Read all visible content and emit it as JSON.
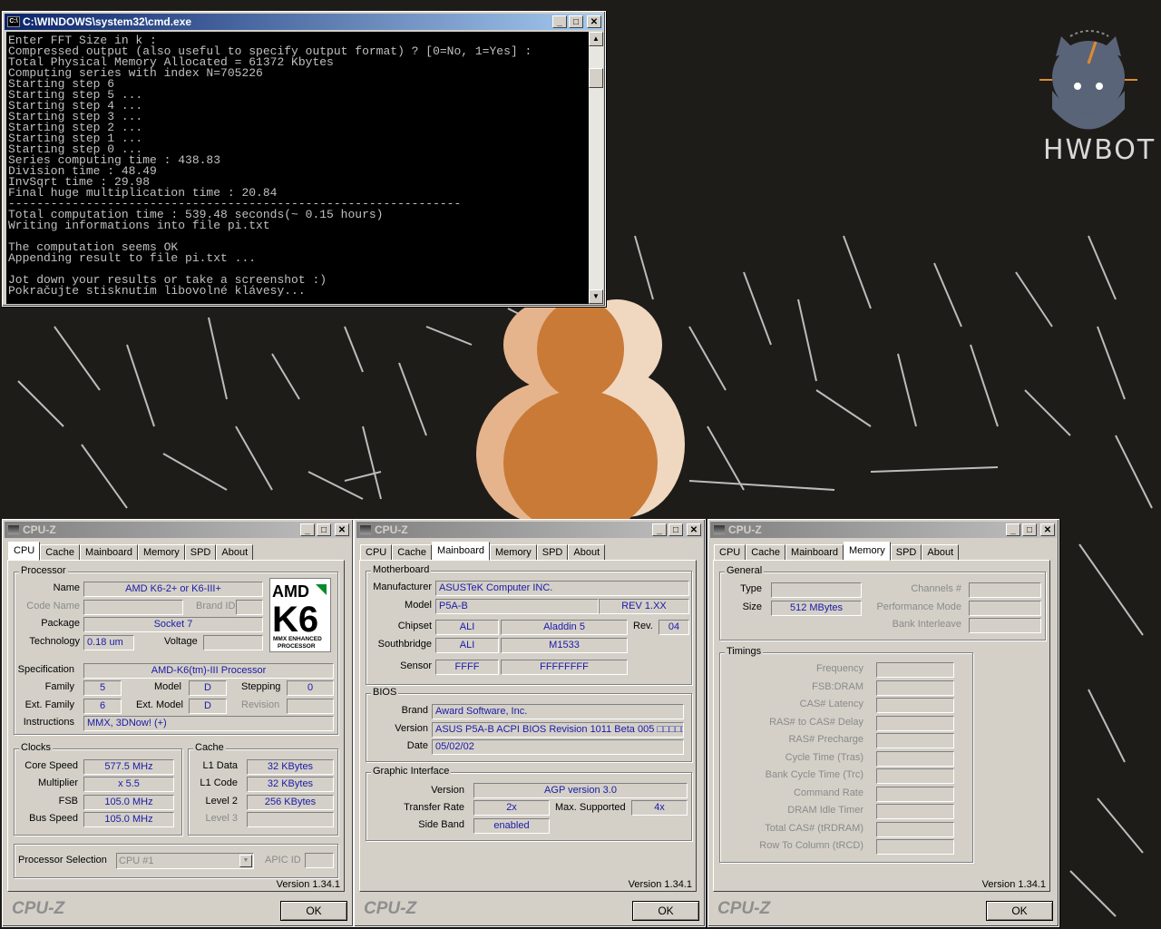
{
  "cmd": {
    "title": "C:\\WINDOWS\\system32\\cmd.exe",
    "lines": [
      "Enter FFT Size in k :",
      "Compressed output (also useful to specify output format) ? [0=No, 1=Yes] :",
      "Total Physical Memory Allocated = 61372 Kbytes",
      "Computing series with index N=705226",
      "Starting step 6",
      "Starting step 5 ...",
      "Starting step 4 ...",
      "Starting step 3 ...",
      "Starting step 2 ...",
      "Starting step 1 ...",
      "Starting step 0 ...",
      "Series computing time : 438.83",
      "Division time : 48.49",
      "InvSqrt time : 29.98",
      "Final huge multiplication time : 20.84",
      "----------------------------------------------------------------",
      "Total computation time : 539.48 seconds(~ 0.15 hours)",
      "Writing informations into file pi.txt",
      "",
      "The computation seems OK",
      "Appending result to file pi.txt ...",
      "",
      "Jot down your results or take a screenshot :)",
      "Pokračujte stisknutím libovolné klávesy..."
    ]
  },
  "hwbot": {
    "logo_text": "HWBOT"
  },
  "cpuz_common": {
    "title": "CPU-Z",
    "tabs": [
      "CPU",
      "Cache",
      "Mainboard",
      "Memory",
      "SPD",
      "About"
    ],
    "version": "Version 1.34.1",
    "brand": "CPU-Z",
    "ok": "OK"
  },
  "cpu": {
    "processor_group": "Processor",
    "name_label": "Name",
    "name": "AMD K6-2+ or K6-III+",
    "codename_label": "Code Name",
    "brandid_label": "Brand ID",
    "package_label": "Package",
    "package": "Socket 7",
    "technology_label": "Technology",
    "technology": "0.18 um",
    "voltage_label": "Voltage",
    "spec_label": "Specification",
    "spec": "AMD-K6(tm)-III Processor",
    "family_label": "Family",
    "family": "5",
    "model_label": "Model",
    "model": "D",
    "stepping_label": "Stepping",
    "stepping": "0",
    "extfamily_label": "Ext. Family",
    "extfamily": "6",
    "extmodel_label": "Ext. Model",
    "extmodel": "D",
    "revision_label": "Revision",
    "instructions_label": "Instructions",
    "instructions": "MMX, 3DNow! (+)",
    "clocks_group": "Clocks",
    "corespeed_label": "Core Speed",
    "corespeed": "577.5 MHz",
    "multiplier_label": "Multiplier",
    "multiplier": "x 5.5",
    "fsb_label": "FSB",
    "fsb": "105.0 MHz",
    "busspeed_label": "Bus Speed",
    "busspeed": "105.0 MHz",
    "cache_group": "Cache",
    "l1data_label": "L1 Data",
    "l1data": "32 KBytes",
    "l1code_label": "L1 Code",
    "l1code": "32 KBytes",
    "level2_label": "Level 2",
    "level2": "256 KBytes",
    "level3_label": "Level 3",
    "procsel_label": "Processor Selection",
    "procsel": "CPU #1",
    "apicid_label": "APIC ID",
    "amd_logo": {
      "top": "AMD",
      "middle": "K6",
      "line1": "MMX ENHANCED",
      "line2": "PROCESSOR"
    }
  },
  "mainboard": {
    "mb_group": "Motherboard",
    "manufacturer_label": "Manufacturer",
    "manufacturer": "ASUSTeK Computer INC.",
    "model_label": "Model",
    "model": "P5A-B",
    "model_rev": "REV 1.XX",
    "chipset_label": "Chipset",
    "chipset_vendor": "ALI",
    "chipset_name": "Aladdin 5",
    "rev_label": "Rev.",
    "rev": "04",
    "south_label": "Southbridge",
    "south_vendor": "ALI",
    "south_name": "M1533",
    "sensor_label": "Sensor",
    "sensor_a": "FFFF",
    "sensor_b": "FFFFFFFF",
    "bios_group": "BIOS",
    "brand_label": "Brand",
    "brand": "Award Software, Inc.",
    "version_label": "Version",
    "version": "ASUS P5A-B ACPI BIOS Revision 1011 Beta 005 □□□□□",
    "date_label": "Date",
    "date": "05/02/02",
    "gi_group": "Graphic Interface",
    "giversion_label": "Version",
    "giversion": "AGP version 3.0",
    "transfer_label": "Transfer Rate",
    "transfer": "2x",
    "maxsup_label": "Max. Supported",
    "maxsup": "4x",
    "sideband_label": "Side Band",
    "sideband": "enabled"
  },
  "memory": {
    "general_group": "General",
    "type_label": "Type",
    "size_label": "Size",
    "size": "512 MBytes",
    "channels_label": "Channels #",
    "perfmode_label": "Performance Mode",
    "bankint_label": "Bank Interleave",
    "timings_group": "Timings",
    "timings": [
      "Frequency",
      "FSB:DRAM",
      "CAS# Latency",
      "RAS# to CAS# Delay",
      "RAS# Precharge",
      "Cycle Time (Tras)",
      "Bank Cycle Time (Trc)",
      "Command Rate",
      "DRAM Idle Timer",
      "Total CAS# (tRDRAM)",
      "Row To Column (tRCD)"
    ]
  }
}
